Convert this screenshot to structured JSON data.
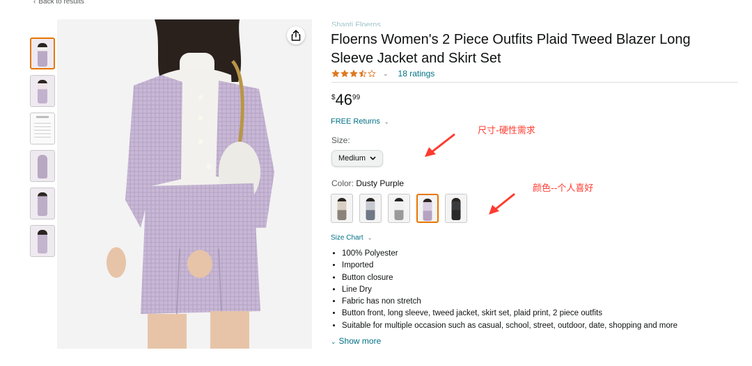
{
  "nav": {
    "back_label": "Back to results"
  },
  "product": {
    "brand_link": "Shanti Floerns",
    "title": "Floerns Women's 2 Piece Outfits Plaid Tweed Blazer Long Sleeve Jacket and Skirt Set",
    "rating": 3.5,
    "ratings_count": "18 ratings",
    "price": {
      "symbol": "$",
      "whole": "46",
      "fraction": "99"
    },
    "returns_label": "FREE Returns",
    "size": {
      "label": "Size:",
      "selected": "Medium"
    },
    "color": {
      "label": "Color:",
      "selected": "Dusty Purple",
      "swatches": [
        {
          "name": "Beige Plaid",
          "top": "#d8cfc2",
          "bottom": "#8b8379"
        },
        {
          "name": "Grey Blue",
          "top": "#c6c9cf",
          "bottom": "#6f7886"
        },
        {
          "name": "White Grey",
          "top": "#f0f0f0",
          "bottom": "#9a9a9a"
        },
        {
          "name": "Dusty Purple",
          "top": "#d9cfe0",
          "bottom": "#b4a3c2"
        },
        {
          "name": "Black",
          "top": "#3a3a3a",
          "bottom": "#2a2a2a"
        }
      ]
    },
    "size_chart_label": "Size Chart",
    "bullets": [
      "100% Polyester",
      "Imported",
      "Button closure",
      "Line Dry",
      "Fabric has non stretch",
      "Button front, long sleeve, tweed jacket, skirt set, plaid print, 2 piece outfits",
      "Suitable for multiple occasion such as casual, school, street, outdoor, date, shopping and more"
    ],
    "show_more_label": "Show more"
  },
  "annotations": {
    "size_note": "尺寸-硬性需求",
    "color_note": "颜色--个人喜好",
    "color_hex": "#ff3b2f"
  },
  "icons": {
    "share": "share-icon",
    "chevron": "chevron-down-icon",
    "star": "star-icon"
  }
}
